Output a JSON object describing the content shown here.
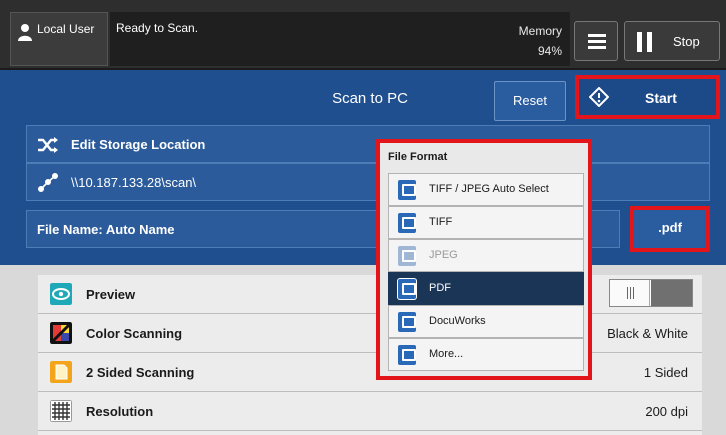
{
  "topbar": {
    "user_label": "Local User",
    "status_text": "Ready to Scan.",
    "memory_label": "Memory",
    "memory_value": "94%",
    "stop_label": "Stop"
  },
  "header": {
    "title": "Scan to PC",
    "reset_label": "Reset",
    "start_label": "Start"
  },
  "location": {
    "edit_label": "Edit Storage Location",
    "path": "\\\\10.187.133.28\\scan\\"
  },
  "filename": {
    "label": "File Name: Auto Name",
    "format_button": ".pdf"
  },
  "file_format_popup": {
    "title": "File Format",
    "options": [
      {
        "label": "TIFF / JPEG Auto Select",
        "state": "enabled"
      },
      {
        "label": "TIFF",
        "state": "enabled"
      },
      {
        "label": "JPEG",
        "state": "disabled"
      },
      {
        "label": "PDF",
        "state": "selected"
      },
      {
        "label": "DocuWorks",
        "state": "enabled"
      },
      {
        "label": "More...",
        "state": "enabled"
      }
    ]
  },
  "settings": [
    {
      "label": "Preview",
      "value": "",
      "icon": "eye-icon"
    },
    {
      "label": "Color Scanning",
      "value": "Black & White",
      "icon": "color-icon"
    },
    {
      "label": "2 Sided Scanning",
      "value": "1 Sided",
      "icon": "page-icon"
    },
    {
      "label": "Resolution",
      "value": "200 dpi",
      "icon": "grid-icon"
    }
  ],
  "colors": {
    "accent_blue": "#1f4f8f",
    "highlight_red": "#e4141b",
    "selected_item": "#1b3556"
  }
}
